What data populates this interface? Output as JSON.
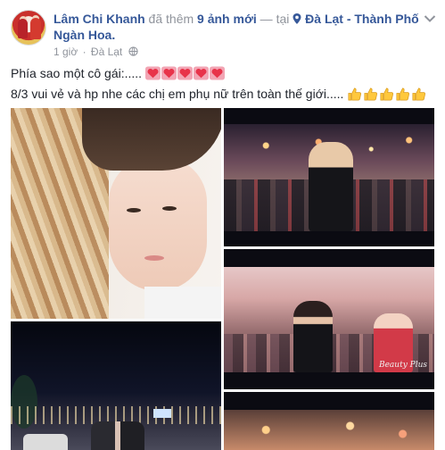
{
  "post": {
    "author": "Lâm Chi Khanh",
    "action_text": " đã thêm ",
    "photo_count_text": "9 ảnh mới",
    "at_text": " — tại ",
    "location": "Đà Lạt - Thành Phố Ngàn Hoa.",
    "time": "1 giờ",
    "meta_sep": "·",
    "meta_place": "Đà Lạt",
    "line1": "Phía sao một cô gái:.....",
    "line2": "8/3 vui vẻ và hp nhe các chị em phụ nữ trên toàn thế giới.....",
    "heart_count": 5,
    "thumbs_count": 5,
    "watermark": "Beauty Plus"
  },
  "icons": {
    "heart": "heart-emoji-icon",
    "thumbs": "thumbs-up-emoji-icon",
    "pin": "location-pin-icon",
    "globe": "globe-icon",
    "chevron": "chevron-down-icon"
  },
  "colors": {
    "link": "#365899",
    "meta": "#90949c",
    "text": "#1d2129",
    "heart": "#e8334a",
    "thumb": "#ffc83d"
  }
}
